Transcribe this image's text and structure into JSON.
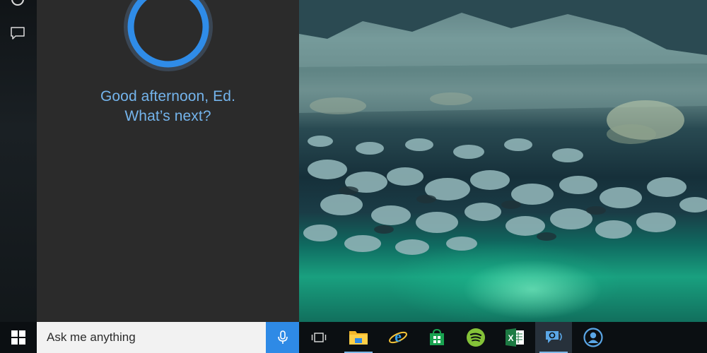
{
  "cortana": {
    "greeting_line1": "Good afternoon, Ed.",
    "greeting_line2": "What’s next?",
    "accent_color": "#74b4ec",
    "ring_color": "#2f8ce8"
  },
  "rail": {
    "icons": [
      "home-icon",
      "feedback-icon"
    ]
  },
  "search": {
    "placeholder": "Ask me anything",
    "mic_icon": "microphone-icon",
    "mic_color": "#2e8ae6"
  },
  "taskbar": {
    "start_icon": "windows-logo-icon",
    "apps": [
      {
        "name": "Task View",
        "icon": "task-view-icon"
      },
      {
        "name": "File Explorer",
        "icon": "folder-icon"
      },
      {
        "name": "Internet Explorer",
        "icon": "internet-explorer-icon"
      },
      {
        "name": "Store",
        "icon": "store-icon"
      },
      {
        "name": "Spotify",
        "icon": "spotify-icon"
      },
      {
        "name": "Excel",
        "icon": "excel-icon"
      },
      {
        "name": "Cortana",
        "icon": "cortana-icon"
      },
      {
        "name": "People",
        "icon": "people-icon"
      }
    ]
  }
}
